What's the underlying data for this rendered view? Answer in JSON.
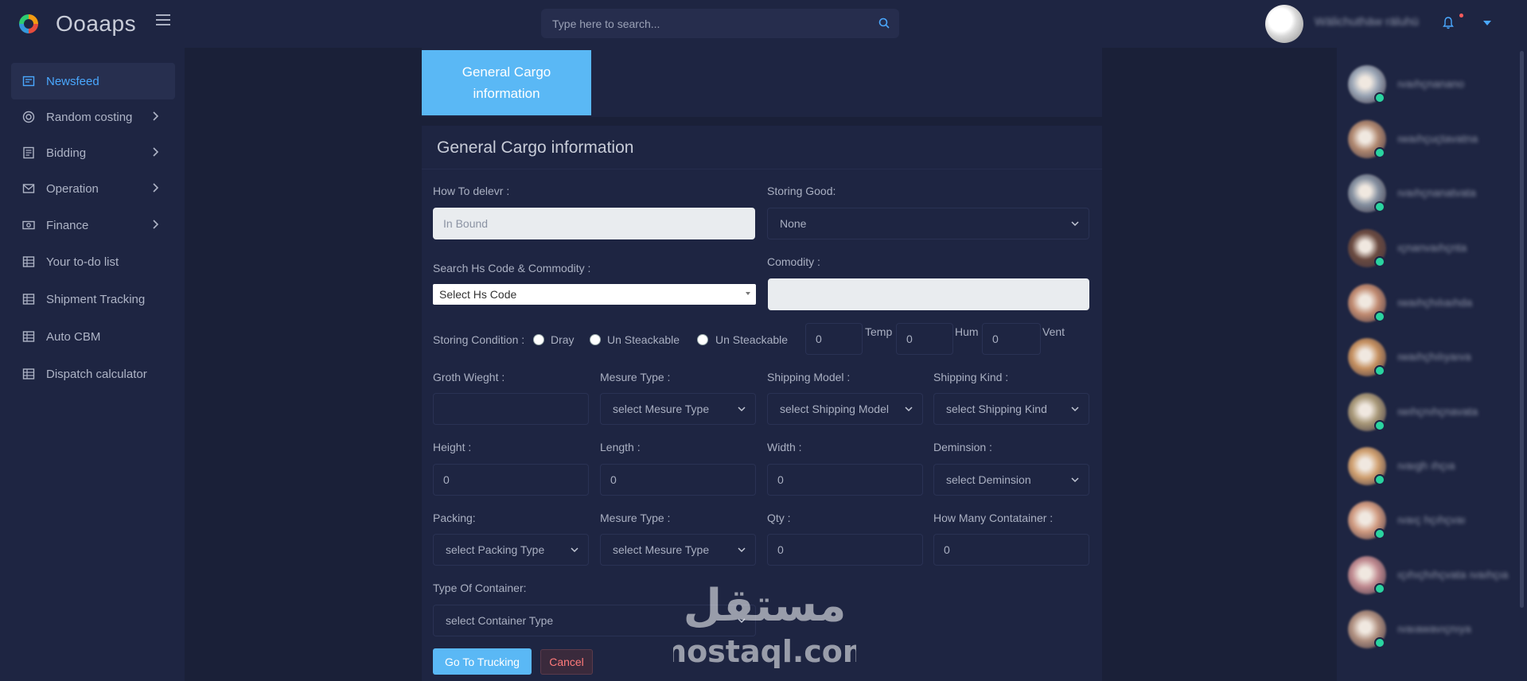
{
  "header": {
    "app_name": "Ooaaps",
    "search_placeholder": "Type here to search...",
    "user_name": "Wälichuthäw räluhü",
    "accent": "#4aa8ff"
  },
  "sidebar": {
    "items": [
      {
        "label": "Newsfeed",
        "icon": "newsfeed-icon",
        "active": true,
        "has_children": false
      },
      {
        "label": "Random costing",
        "icon": "target-icon",
        "active": false,
        "has_children": true
      },
      {
        "label": "Bidding",
        "icon": "document-icon",
        "active": false,
        "has_children": true
      },
      {
        "label": "Operation",
        "icon": "mail-icon",
        "active": false,
        "has_children": true
      },
      {
        "label": "Finance",
        "icon": "money-icon",
        "active": false,
        "has_children": true
      },
      {
        "label": "Your to-do list",
        "icon": "list-icon",
        "active": false,
        "has_children": false
      },
      {
        "label": "Shipment Tracking",
        "icon": "list-icon",
        "active": false,
        "has_children": false
      },
      {
        "label": "Auto CBM",
        "icon": "list-icon",
        "active": false,
        "has_children": false
      },
      {
        "label": "Dispatch calculator",
        "icon": "list-icon",
        "active": false,
        "has_children": false
      }
    ]
  },
  "tab": {
    "label": "General Cargo information"
  },
  "form": {
    "title": "General Cargo information",
    "how_to_deliver": {
      "label": "How To delevr :",
      "placeholder": "In Bound"
    },
    "storing_good": {
      "label": "Storing Good:",
      "value": "None"
    },
    "hs_code": {
      "label": "Search Hs Code & Commodity :",
      "value": "Select Hs Code"
    },
    "commodity": {
      "label": "Comodity :",
      "value": ""
    },
    "storing_condition": {
      "label": "Storing Condition :",
      "options": [
        "Dray",
        "Un Steackable",
        "Un Steackable"
      ],
      "temp_label": "Temp",
      "hum_label": "Hum",
      "vent_label": "Vent",
      "temp_value": "0",
      "hum_value": "0",
      "vent_value": "0"
    },
    "groth_weight": {
      "label": "Groth Wieght :",
      "value": ""
    },
    "mesure_type_1": {
      "label": "Mesure Type :",
      "value": "select Mesure Type"
    },
    "shipping_model": {
      "label": "Shipping Model :",
      "value": "select Shipping Model"
    },
    "shipping_kind": {
      "label": "Shipping Kind :",
      "value": "select Shipping Kind"
    },
    "height": {
      "label": "Height :",
      "value": "0"
    },
    "length": {
      "label": "Length :",
      "value": "0"
    },
    "width": {
      "label": "Width :",
      "value": "0"
    },
    "demension": {
      "label": "Deminsion :",
      "value": "select Deminsion"
    },
    "packing": {
      "label": "Packing:",
      "value": "select Packing Type"
    },
    "mesure_type_2": {
      "label": "Mesure Type :",
      "value": "select Mesure Type"
    },
    "qty": {
      "label": "Qty :",
      "value": "0"
    },
    "how_many_container": {
      "label": "How Many Contatainer :",
      "value": "0"
    },
    "container_type": {
      "label": "Type Of Container:",
      "value": "select Container Type"
    },
    "submit_label": "Go To Trucking",
    "cancel_label": "Cancel"
  },
  "watermark": {
    "arabic": "مستقل",
    "latin": "mostaql.com"
  },
  "contacts": [
    {
      "name": "ıvaıhçnanano",
      "avatar_color": "#9aa5b5"
    },
    {
      "name": "ıwaıhçuçtavatna",
      "avatar_color": "#b08870"
    },
    {
      "name": "ıvaıhçnanatvata",
      "avatar_color": "#8590a0"
    },
    {
      "name": "ıçnanvaıhçnta",
      "avatar_color": "#6a4a40"
    },
    {
      "name": "ıwaıhçhılıaıhda",
      "avatar_color": "#c08a70"
    },
    {
      "name": "ıwaıhçhılıyaıva",
      "avatar_color": "#c59060"
    },
    {
      "name": "ıwıhçnıhçnavata",
      "avatar_color": "#a89878"
    },
    {
      "name": "ıvaıgh ıhçıa",
      "avatar_color": "#d0a070"
    },
    {
      "name": "ıvaıç hçıhçvaı",
      "avatar_color": "#d09a80"
    },
    {
      "name": "ıçıhıçhıhçvata ıvaıhçıa",
      "avatar_color": "#c08a90"
    },
    {
      "name": "ıvaıawavıçnıya",
      "avatar_color": "#b09080"
    }
  ]
}
